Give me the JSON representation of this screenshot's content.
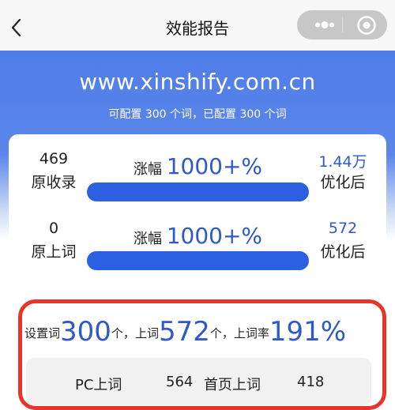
{
  "nav": {
    "title": "效能报告"
  },
  "hero": {
    "domain": "www.xinshify.com.cn",
    "quota": "可配置 300 个词，已配置 300 个词"
  },
  "records": {
    "left_value": "469",
    "left_label": "原收录",
    "growth_label": "涨幅",
    "growth_value": "1000+%",
    "right_value": "1.44万",
    "right_label": "优化后",
    "progress": 1.0
  },
  "ranked": {
    "left_value": "0",
    "left_label": "原上词",
    "growth_label": "涨幅",
    "growth_value": "1000+%",
    "right_value": "572",
    "right_label": "优化后",
    "progress": 1.0
  },
  "summary": {
    "set_label": "设置词",
    "set_value": "300",
    "unit1": "个，",
    "ranked_label": "上词",
    "ranked_value": "572",
    "unit2": "个，",
    "rate_label": "上词率",
    "rate_value": "191%"
  },
  "detail": {
    "pc_label": "PC上词",
    "pc_value": "564",
    "home_label": "首页上词",
    "home_value": "418"
  },
  "colors": {
    "accent": "#2d5fe3",
    "highlight_border": "#e8352b"
  }
}
